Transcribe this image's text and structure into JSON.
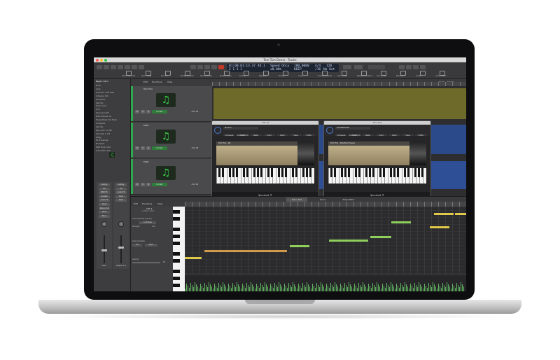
{
  "window": {
    "title": "Tom Tom Demo - Tracks"
  },
  "lcd": {
    "time": "01:00:01:13.37",
    "bars": "2  1  1  1",
    "tempo": "44.1",
    "mode": "Speed Only",
    "sample": "100,0000",
    "ts": "4/4",
    "keep": "KEEP",
    "div": "/16",
    "zero": "±0.00%",
    "in": "128",
    "out": "No Out"
  },
  "toolbar": {
    "labels": [
      "Smart Controls",
      "Quick Help",
      "Tool Kit",
      "Media Browser",
      "Smart Tempo",
      "Master Fader",
      "Tuning",
      "Replace",
      "Tempo",
      "Loop",
      "Tuning Controls",
      "Auto Loop",
      "Replace Sections",
      "Live Loops",
      "Browsers",
      "Loops",
      "Audio Editor"
    ]
  },
  "inspector": {
    "region_label": "Region: Inst 1",
    "rows": [
      "Mute:",
      "Loop:",
      "Quantize: 1/16 Note",
      "Q-Swing: 100",
      "Transpose:",
      "Velocity:",
      "Track: Inst 1",
      "Icon:",
      "Channel: Inst 1",
      "MIDI Channel: All",
      "Freeze Mode: Pre Fader",
      "Transpose:",
      "Velocity:",
      "Key Limit: C-2 G8",
      "Vel Limit: 1 127",
      "Delay:",
      "No Transpose:",
      "No Reset:",
      "Staff Style: Auto",
      "Articulation Set:"
    ],
    "strip_buttons": [
      "Setting",
      "EQ",
      "MIDI FX",
      "Kontakt",
      "Audio FX",
      "Send",
      "Stereo Out",
      "Read",
      "Bnce",
      "Setting",
      "EQ",
      "Audio FX",
      "Send",
      "Read"
    ],
    "strip_names": [
      "Inst 1",
      "Output 1-2"
    ]
  },
  "tracks_menu": [
    "Edit",
    "Functions",
    "View"
  ],
  "tracks": [
    {
      "name": "Tom Tom",
      "sub": "Kontakt",
      "vol": "-22.0 dB"
    },
    {
      "name": "Multi",
      "sub": "Kontakt",
      "vol": "-12.6 dB"
    },
    {
      "name": "Multi",
      "sub": "Kontakt",
      "vol": "-12.6 dB"
    }
  ],
  "track_buttons": {
    "mute": "M",
    "solo": "S",
    "rec": "R"
  },
  "plugins": [
    {
      "title": "Inst 12",
      "preset": "Manual",
      "header": "Tom Tom - Kit",
      "footer": "Kontakt 5",
      "segments": [
        "Compare",
        "Copy",
        "Paste",
        "Undo",
        "Redo",
        "View",
        "Editor"
      ]
    },
    {
      "title": "Tom Tom",
      "preset": "#CKKBRAKOR",
      "header": "Tom Tom - Rhythmic Space",
      "footer": "Kontakt 5",
      "segments": [
        "Compare",
        "Copy",
        "Paste",
        "Undo",
        "Redo",
        "View",
        "Editor"
      ]
    }
  ],
  "editor": {
    "tabs": [
      "Piano Roll",
      "Score",
      "Step Editor"
    ],
    "menu": [
      "Edit",
      "Functions",
      "View"
    ],
    "region_name": "Inst 1",
    "region_sub": "in Track: Inst 1",
    "quantize_label": "Time Quantize (classic)",
    "quantize_value": "1/16 Note",
    "strength_label": "Strength",
    "strength_value": "100",
    "scale_label": "Scale Quantize",
    "scale_off": "Off",
    "scale_major": "Major",
    "velocity_label": "Velocity",
    "velocity_value": "80",
    "snap_label": "Snap:",
    "snap_value": "Smart"
  },
  "colors": {
    "accent_green": "#3bd24a",
    "olive_region": "#6e6b2a",
    "blue_region": "#2b4a8a",
    "note_yellow": "#e0c84a",
    "note_green": "#8fd05a",
    "note_orange": "#d09a4a"
  }
}
